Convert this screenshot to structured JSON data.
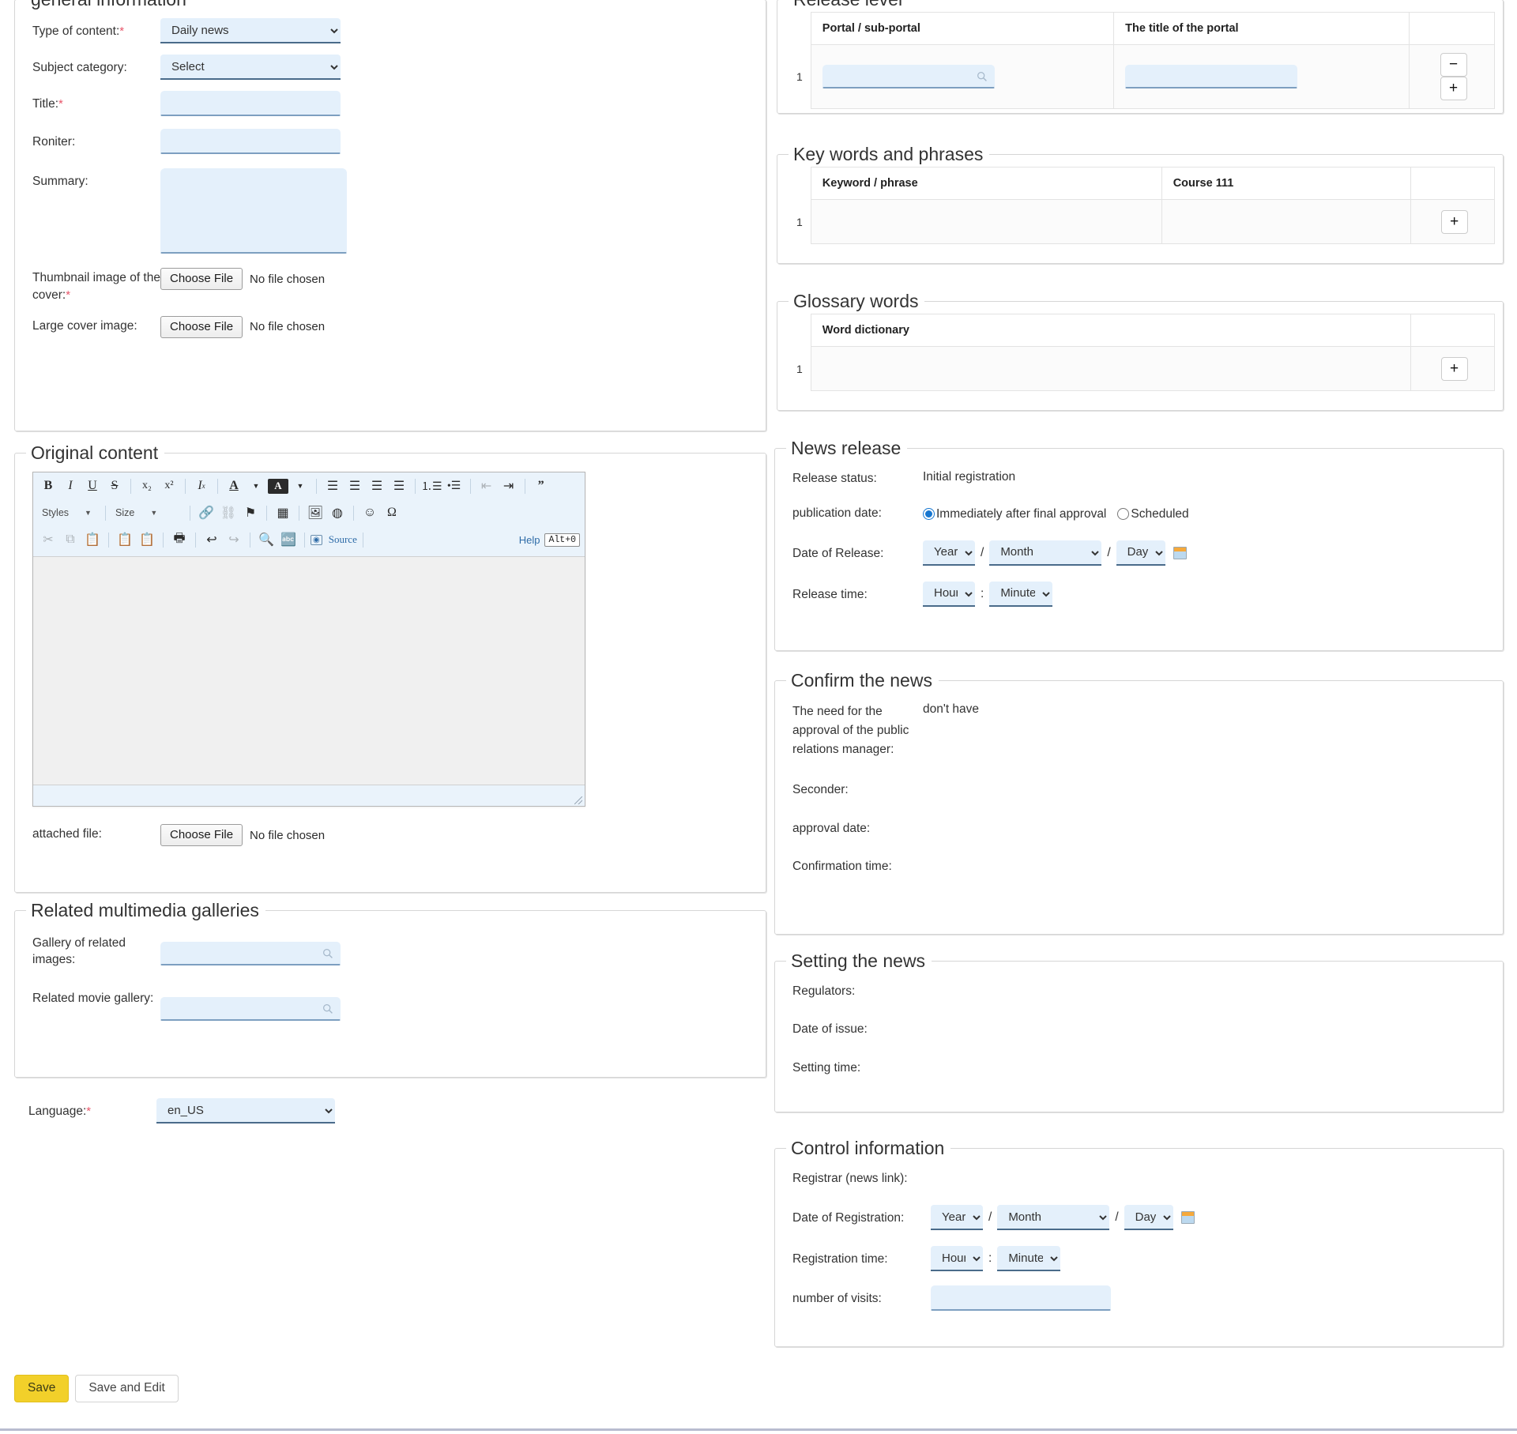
{
  "general_information": {
    "legend": "general information",
    "fields": {
      "type_of_content": {
        "label": "Type of content:",
        "required": true,
        "value": "Daily news"
      },
      "subject_category": {
        "label": "Subject category:",
        "required": false,
        "value": "Select"
      },
      "title": {
        "label": "Title:",
        "required": true,
        "value": ""
      },
      "roniter": {
        "label": "Roniter:",
        "required": false,
        "value": ""
      },
      "summary": {
        "label": "Summary:",
        "required": false,
        "value": ""
      },
      "thumbnail": {
        "label": "Thumbnail image of the cover:",
        "required": true,
        "button": "Choose File",
        "status": "No file chosen"
      },
      "large_cover": {
        "label": "Large cover image:",
        "required": false,
        "button": "Choose File",
        "status": "No file chosen"
      }
    }
  },
  "original_content": {
    "legend": "Original content",
    "editor": {
      "toolbar_row1": [
        "B",
        "I",
        "U",
        "S",
        "x₂",
        "x²",
        "Ix",
        "A",
        "A",
        "≡",
        "≡",
        "≡",
        "≡",
        "⋮≡",
        "⋮≡",
        "⇥",
        "⇤",
        "”"
      ],
      "styles_label": "Styles",
      "size_label": "Size",
      "source_label": "Source",
      "help_label": "Help",
      "help_shortcut": "Alt+0",
      "content": ""
    },
    "attached_file": {
      "label": "attached file:",
      "button": "Choose File",
      "status": "No file chosen"
    }
  },
  "related_multimedia": {
    "legend": "Related multimedia galleries",
    "fields": {
      "image_gallery": {
        "label": "Gallery of related images:",
        "value": ""
      },
      "movie_gallery": {
        "label": "Related movie gallery:",
        "value": ""
      }
    }
  },
  "language": {
    "label": "Language:",
    "required": true,
    "value": "en_US"
  },
  "release_level": {
    "legend": "Release level",
    "columns": [
      "Portal / sub-portal",
      "The title of the portal",
      ""
    ],
    "rows": [
      {
        "index": "1",
        "portal": "",
        "title": ""
      }
    ],
    "remove_label": "−",
    "add_label": "+"
  },
  "key_words": {
    "legend": "Key words and phrases",
    "columns": [
      "Keyword / phrase",
      "Course 111",
      ""
    ],
    "rows": [
      {
        "index": "1",
        "keyword": "",
        "course": ""
      }
    ],
    "add_label": "+"
  },
  "glossary_words": {
    "legend": "Glossary words",
    "columns": [
      "Word dictionary",
      ""
    ],
    "rows": [
      {
        "index": "1",
        "word": ""
      }
    ],
    "add_label": "+"
  },
  "news_release": {
    "legend": "News release",
    "release_status": {
      "label": "Release status:",
      "value": "Initial registration"
    },
    "publication_date": {
      "label": "publication date:",
      "option_immediate": "Immediately after final approval",
      "option_scheduled": "Scheduled",
      "selected": "immediate"
    },
    "date_of_release": {
      "label": "Date of Release:",
      "year": "Year",
      "month": "Month",
      "day": "Day",
      "separator": "/"
    },
    "release_time": {
      "label": "Release time:",
      "hour": "Hour",
      "minute": "Minute",
      "separator": ":"
    }
  },
  "confirm_the_news": {
    "legend": "Confirm the news",
    "rows": [
      {
        "label": "The need for the approval of the public relations manager:",
        "value": "don't have"
      },
      {
        "label": "Seconder:",
        "value": ""
      },
      {
        "label": "approval date:",
        "value": ""
      },
      {
        "label": "Confirmation time:",
        "value": ""
      }
    ]
  },
  "setting_the_news": {
    "legend": "Setting the news",
    "rows": [
      {
        "label": "Regulators:",
        "value": ""
      },
      {
        "label": "Date of issue:",
        "value": ""
      },
      {
        "label": "Setting time:",
        "value": ""
      }
    ]
  },
  "control_information": {
    "legend": "Control information",
    "registrar": {
      "label": "Registrar (news link):",
      "value": ""
    },
    "date_of_registration": {
      "label": "Date of Registration:",
      "year": "Year",
      "month": "Month",
      "day": "Day",
      "separator": "/"
    },
    "registration_time": {
      "label": "Registration time:",
      "hour": "Hour",
      "minute": "Minute",
      "separator": ":"
    },
    "number_of_visits": {
      "label": "number of visits:",
      "value": ""
    }
  },
  "actions": {
    "save": "Save",
    "save_and_edit": "Save and Edit"
  },
  "colors": {
    "input_bg": "#e4f0fb",
    "input_underline": "#7d9fc0",
    "save_button": "#f2d02a",
    "required_marker": "#e8566a",
    "status_text": "#333333"
  }
}
